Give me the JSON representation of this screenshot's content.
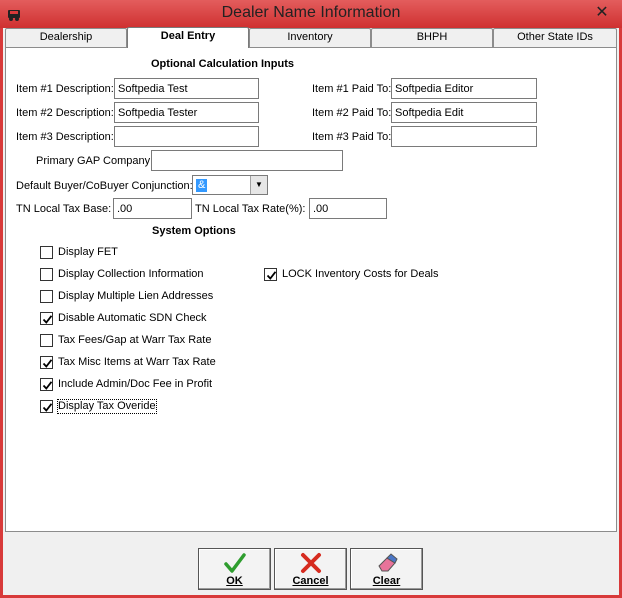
{
  "window": {
    "title": "Dealer Name Information",
    "close_glyph": "✕",
    "icon": "car-icon"
  },
  "tabs": [
    {
      "label": "Dealership",
      "active": false
    },
    {
      "label": "Deal Entry",
      "active": true
    },
    {
      "label": "Inventory",
      "active": false
    },
    {
      "label": "BHPH",
      "active": false
    },
    {
      "label": "Other State IDs",
      "active": false
    }
  ],
  "optional": {
    "title": "Optional Calculation Inputs",
    "item1_desc_label": "Item #1 Description:",
    "item1_desc_value": "Softpedia Test",
    "item2_desc_label": "Item #2 Description:",
    "item2_desc_value": "Softpedia Tester",
    "item3_desc_label": "Item #3 Description:",
    "item3_desc_value": "",
    "item1_paid_label": "Item #1 Paid To:",
    "item1_paid_value": "Softpedia Editor",
    "item2_paid_label": "Item #2 Paid To:",
    "item2_paid_value": "Softpedia Edit",
    "item3_paid_label": "Item #3 Paid To:",
    "item3_paid_value": "",
    "gap_label": "Primary GAP Company:",
    "gap_value": "",
    "conjunction_label": "Default Buyer/CoBuyer Conjunction:",
    "conjunction_value": "&",
    "tax_base_label": "TN Local Tax Base:",
    "tax_base_value": ".00",
    "tax_rate_label": "TN Local Tax Rate(%):",
    "tax_rate_value": ".00"
  },
  "system": {
    "title": "System Options",
    "options": [
      {
        "label": "Display FET",
        "checked": false
      },
      {
        "label": "Display Collection Information",
        "checked": false
      },
      {
        "label": "Display Multiple Lien Addresses",
        "checked": false
      },
      {
        "label": "Disable Automatic SDN Check",
        "checked": true
      },
      {
        "label": "Tax Fees/Gap at Warr Tax Rate",
        "checked": false
      },
      {
        "label": "Tax Misc Items at Warr Tax Rate",
        "checked": true
      },
      {
        "label": "Include Admin/Doc Fee in Profit",
        "checked": true
      },
      {
        "label": "Display Tax Overide",
        "checked": true
      }
    ],
    "lock_option": {
      "label": "LOCK Inventory Costs for Deals",
      "checked": true
    }
  },
  "buttons": {
    "ok": {
      "label": "OK",
      "icon": "checkmark-icon",
      "color": "#2e9d2e"
    },
    "cancel": {
      "label": "Cancel",
      "icon": "red-x-icon",
      "color": "#d62b1f"
    },
    "clear": {
      "label": "Clear",
      "icon": "eraser-icon",
      "color": "#e8739a"
    }
  }
}
